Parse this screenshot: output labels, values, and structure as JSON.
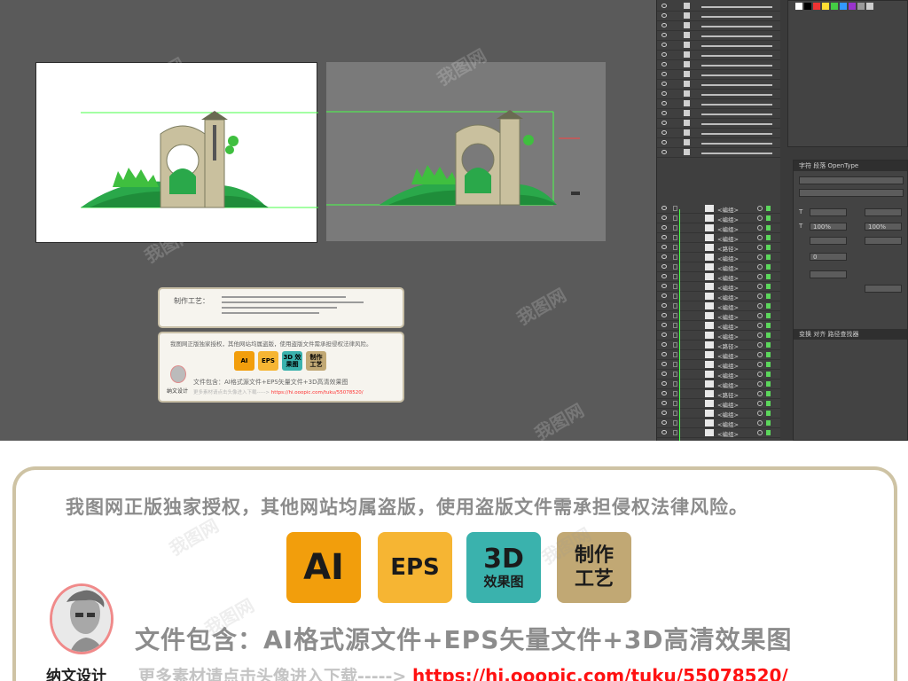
{
  "watermark": "我图网",
  "layers": {
    "rows": [
      "<编组>",
      "<编组>",
      "<编组>",
      "<编组>",
      "<路径>",
      "<编组>",
      "<编组>",
      "<编组>",
      "<编组>",
      "<编组>",
      "<编组>",
      "<编组>",
      "<编组>",
      "<编组>",
      "<路径>",
      "<编组>",
      "<编组>",
      "<编组>",
      "<编组>",
      "<路径>",
      "<编组>",
      "<编组>",
      "<编组>",
      "<编组>"
    ]
  },
  "char_panel": {
    "tabs": "字符 段落 OpenType",
    "size_value": "100%",
    "leading_value": "100%",
    "tracking_value": "0",
    "bottom_tabs": "变换 对齐 路径查找器"
  },
  "thumbnail": {
    "card1_title": "制作工艺：",
    "card2_copyright": "我图网正版独家授权，其他网站均属盗版，使用盗版文件需承担侵权法律风险。",
    "badges": [
      "AI",
      "EPS",
      "3D 效果图",
      "制作 工艺"
    ],
    "designer": "纳文设计",
    "contains": "文件包含：AI格式源文件+EPS矢量文件+3D高清效果图",
    "more": "更多素材请点击头像进入下载----->",
    "url": "https://hi.ooopic.com/tuku/55078520/"
  },
  "banner": {
    "copyright": "我图网正版独家授权，其他网站均属盗版，使用盗版文件需承担侵权法律风险。",
    "badge_ai": "AI",
    "badge_eps": "EPS",
    "badge_3d_top": "3D",
    "badge_3d_bottom": "效果图",
    "badge_craft_top": "制作",
    "badge_craft_bottom": "工艺",
    "designer_name": "纳文设计",
    "contains": "文件包含：AI格式源文件+EPS矢量文件+3D高清效果图",
    "more_text": "更多素材请点击头像进入下载----->",
    "url": "https://hi.ooopic.com/tuku/55078520/"
  },
  "colors": {
    "ai": "#f29e0c",
    "eps": "#f6b533",
    "three_d": "#3ab2ad",
    "craft": "#c1a874",
    "url": "#ff1212",
    "selection": "#49ff49",
    "frame": "#cec3a4"
  }
}
